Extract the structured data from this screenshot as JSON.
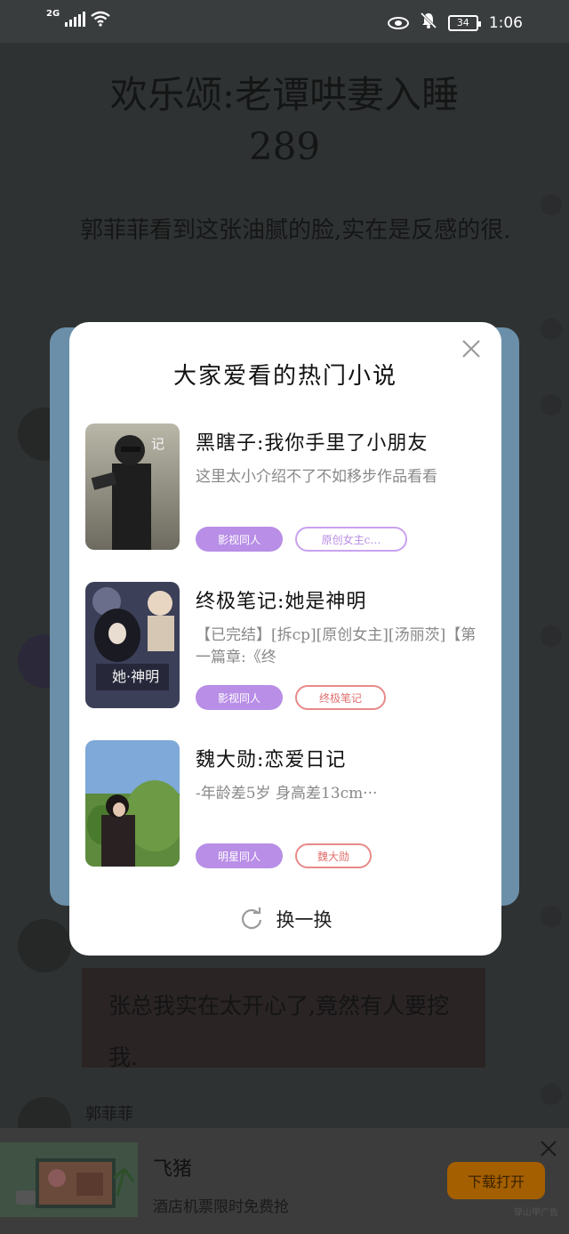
{
  "status_bar": {
    "network": "2G",
    "battery": "34",
    "time": "1:06"
  },
  "reader": {
    "chapter_title": "欢乐颂:老谭哄妻入睡289",
    "paragraph": "郭菲菲看到这张油腻的脸,实在是反感的很.",
    "bubble_text": "张总我实在太开心了,竟然有人要挖我.",
    "name_tag": "郭菲菲"
  },
  "modal": {
    "title": "大家爱看的热门小说",
    "books": [
      {
        "title": "黑瞎子:我你手里了小朋友",
        "desc": "这里太小介绍不了不如移步作品看看",
        "tags": [
          "影视同人",
          "原创女主c…"
        ]
      },
      {
        "title": "终极笔记:她是神明",
        "desc": "【已完结】[拆cp][原创女主][汤丽茨]【第一篇章:《终",
        "tags": [
          "影视同人",
          "终极笔记"
        ]
      },
      {
        "title": "魏大勋:恋爱日记",
        "desc": "-年龄差5岁 身高差13cm···",
        "tags": [
          "明星同人",
          "魏大勋"
        ]
      }
    ],
    "refresh_label": "换一换"
  },
  "ad": {
    "title": "飞猪",
    "subtitle": "酒店机票限时免费抢",
    "button": "下载打开",
    "label": "穿山甲广告"
  },
  "colors": {
    "tag_fill": "#b88ee6",
    "tag_outline_purple": "#c9a2ef",
    "tag_outline_red": "#e88a8a",
    "ad_button": "#a45f00"
  }
}
